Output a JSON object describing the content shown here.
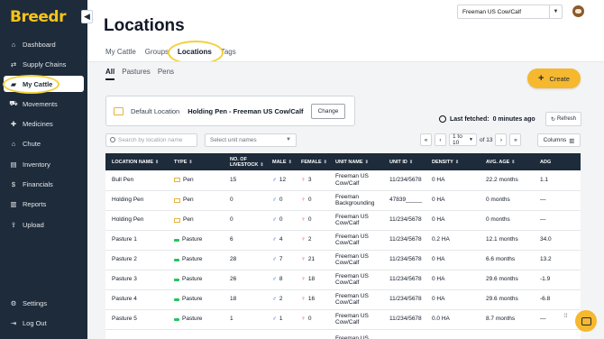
{
  "app": {
    "logo": "Breedr"
  },
  "sidebar": {
    "items": [
      {
        "label": "Dashboard",
        "icon": "⌂"
      },
      {
        "label": "Supply Chains",
        "icon": "⇄"
      },
      {
        "label": "My Cattle",
        "icon": "▰"
      },
      {
        "label": "Movements",
        "icon": "⛟"
      },
      {
        "label": "Medicines",
        "icon": "✚"
      },
      {
        "label": "Chute",
        "icon": "⌂"
      },
      {
        "label": "Inventory",
        "icon": "▤"
      },
      {
        "label": "Financials",
        "icon": "$"
      },
      {
        "label": "Reports",
        "icon": "▥"
      },
      {
        "label": "Upload",
        "icon": "⇪"
      }
    ],
    "settings": {
      "label": "Settings",
      "icon": "⚙"
    },
    "logout": {
      "label": "Log Out",
      "icon": "⇥"
    }
  },
  "header": {
    "title": "Locations",
    "farm_select": "Freeman US Cow/Calf"
  },
  "tabs": [
    "My Cattle",
    "Groups",
    "Locations",
    "Tags"
  ],
  "subtabs": [
    "All",
    "Pastures",
    "Pens"
  ],
  "create_label": "Create",
  "default_location": {
    "label": "Default Location",
    "value": "Holding Pen - Freeman US Cow/Calf",
    "change_label": "Change"
  },
  "last_fetched": {
    "label": "Last fetched:",
    "value": "0 minutes ago",
    "refresh_label": "Refresh"
  },
  "filters": {
    "search_placeholder": "Search by location name",
    "unit_placeholder": "Select unit names"
  },
  "pager": {
    "range": "1 to 10",
    "of": "of 13"
  },
  "columns_label": "Columns",
  "table": {
    "headers": [
      "LOCATION NAME",
      "TYPE",
      "NO. OF LIVESTOCK",
      "MALE",
      "FEMALE",
      "UNIT NAME",
      "UNIT ID",
      "DENSITY",
      "AVG. AGE",
      "ADG"
    ],
    "rows": [
      {
        "name": "Bull Pen",
        "type": "Pen",
        "livestock": "15",
        "male": "12",
        "female": "3",
        "unit": "Freeman US Cow/Calf",
        "unit_id": "11/234/5678",
        "density": "0 HA",
        "age": "22.2 months",
        "adg": "1.1"
      },
      {
        "name": "Holding Pen",
        "type": "Pen",
        "livestock": "0",
        "male": "0",
        "female": "0",
        "unit": "Freeman Backgrounding",
        "unit_id": "47839_____",
        "density": "0 HA",
        "age": "0 months",
        "adg": "—"
      },
      {
        "name": "Holding Pen",
        "type": "Pen",
        "livestock": "0",
        "male": "0",
        "female": "0",
        "unit": "Freeman US Cow/Calf",
        "unit_id": "11/234/5678",
        "density": "0 HA",
        "age": "0 months",
        "adg": "—"
      },
      {
        "name": "Pasture 1",
        "type": "Pasture",
        "livestock": "6",
        "male": "4",
        "female": "2",
        "unit": "Freeman US Cow/Calf",
        "unit_id": "11/234/5678",
        "density": "0.2 HA",
        "age": "12.1 months",
        "adg": "34.0"
      },
      {
        "name": "Pasture 2",
        "type": "Pasture",
        "livestock": "28",
        "male": "7",
        "female": "21",
        "unit": "Freeman US Cow/Calf",
        "unit_id": "11/234/5678",
        "density": "0 HA",
        "age": "6.6 months",
        "adg": "13.2"
      },
      {
        "name": "Pasture 3",
        "type": "Pasture",
        "livestock": "26",
        "male": "8",
        "female": "18",
        "unit": "Freeman US Cow/Calf",
        "unit_id": "11/234/5678",
        "density": "0 HA",
        "age": "29.6 months",
        "adg": "-1.9"
      },
      {
        "name": "Pasture 4",
        "type": "Pasture",
        "livestock": "18",
        "male": "2",
        "female": "16",
        "unit": "Freeman US Cow/Calf",
        "unit_id": "11/234/5678",
        "density": "0 HA",
        "age": "29.6 months",
        "adg": "-6.8"
      },
      {
        "name": "Pasture 5",
        "type": "Pasture",
        "livestock": "1",
        "male": "1",
        "female": "0",
        "unit": "Freeman US Cow/Calf",
        "unit_id": "11/234/5678",
        "density": "0.0 HA",
        "age": "8.7 months",
        "adg": "—"
      },
      {
        "name": "",
        "type": "",
        "livestock": "",
        "male": "",
        "female": "",
        "unit": "Freeman US",
        "unit_id": "",
        "density": "",
        "age": "",
        "adg": ""
      }
    ]
  },
  "colors": {
    "sidebar": "#1d2b3a",
    "accent": "#f5b82e",
    "highlight": "#f2d03b"
  }
}
